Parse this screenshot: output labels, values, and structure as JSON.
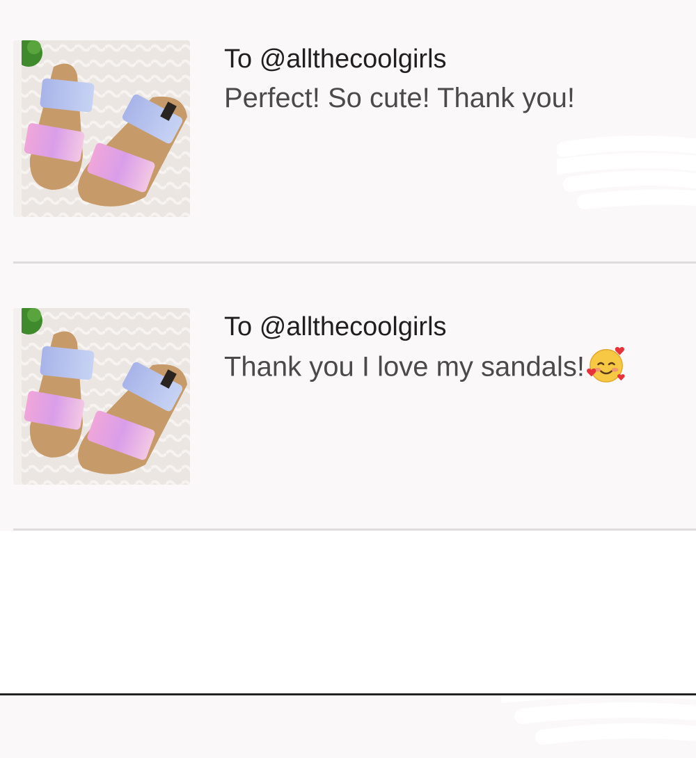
{
  "reviews": [
    {
      "recipient_prefix": "To",
      "recipient_handle": "@allthecoolgirls",
      "message": "Perfect! So cute! Thank you!",
      "has_emoji": false
    },
    {
      "recipient_prefix": "To",
      "recipient_handle": "@allthecoolgirls",
      "message": "Thank you I love my sandals!",
      "has_emoji": true,
      "emoji": "smiling-face-with-hearts-icon"
    }
  ],
  "colors": {
    "background": "#fbf8f9",
    "divider": "#dddbdc",
    "recipient_text": "#1f1f1f",
    "message_text": "#4a4a4a",
    "strap_holographic_pink": "#e8a6e0",
    "strap_holographic_blue": "#9fb0e6",
    "sole_tan": "#c79a6a"
  }
}
